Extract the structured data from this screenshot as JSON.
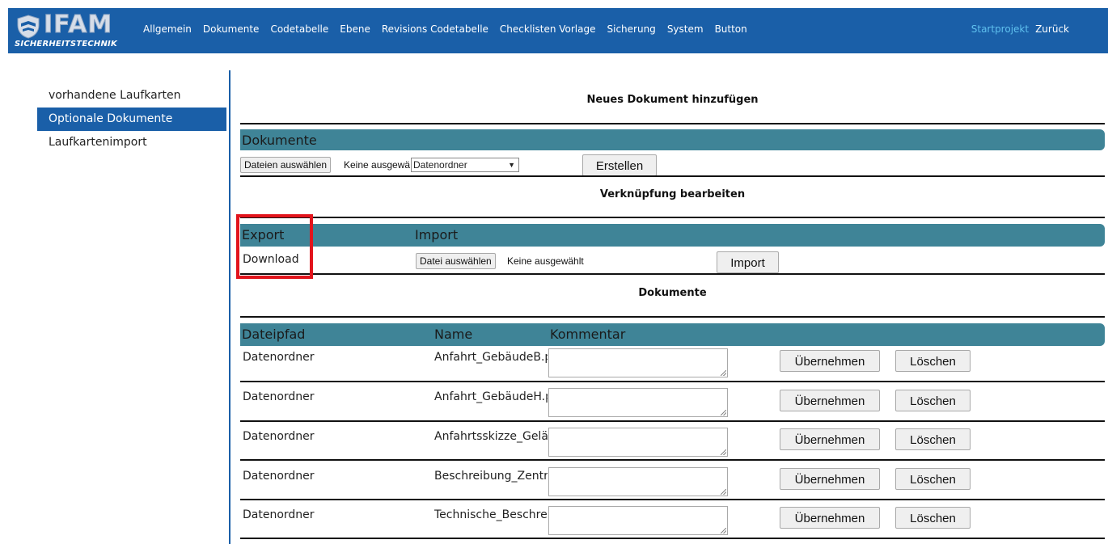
{
  "brand": {
    "word": "IFAM",
    "sub": "SICHERHEITSTECHNIK"
  },
  "nav": {
    "items": [
      "Allgemein",
      "Dokumente",
      "Codetabelle",
      "Ebene",
      "Revisions Codetabelle",
      "Checklisten Vorlage",
      "Sicherung",
      "System",
      "Button"
    ],
    "startprojekt": "Startprojekt",
    "zurueck": "Zurück"
  },
  "sidebar": {
    "items": [
      {
        "label": "vorhandene Laufkarten"
      },
      {
        "label": "Optionale Dokumente"
      },
      {
        "label": "Laufkartenimport"
      }
    ]
  },
  "neues": {
    "title": "Neues Dokument hinzufügen",
    "bar_label": "Dokumente",
    "file_button": "Dateien auswählen",
    "file_status": "Keine ausgewä",
    "select_value": "Datenordner",
    "create_button": "Erstellen"
  },
  "verknuepfung": {
    "title": "Verknüpfung bearbeiten",
    "export_label": "Export",
    "import_label": "Import",
    "download_link": "Download",
    "file_button": "Datei auswählen",
    "file_status": "Keine ausgewählt",
    "import_button": "Import"
  },
  "dokumente": {
    "title": "Dokumente",
    "columns": [
      "Dateipfad",
      "Name",
      "Kommentar"
    ],
    "apply_label": "Übernehmen",
    "delete_label": "Löschen",
    "rows": [
      {
        "path": "Datenordner",
        "name": "Anfahrt_GebäudeB.pd"
      },
      {
        "path": "Datenordner",
        "name": "Anfahrt_GebäudeH.pd"
      },
      {
        "path": "Datenordner",
        "name": "Anfahrtsskizze_Geländ"
      },
      {
        "path": "Datenordner",
        "name": "Beschreibung_Zentral"
      },
      {
        "path": "Datenordner",
        "name": "Technische_Beschreib"
      }
    ]
  },
  "colors": {
    "navbar": "#1a5fa8",
    "teal": "#3f8497",
    "highlight": "#e2141c",
    "startprojekt": "#5fc0ee"
  }
}
